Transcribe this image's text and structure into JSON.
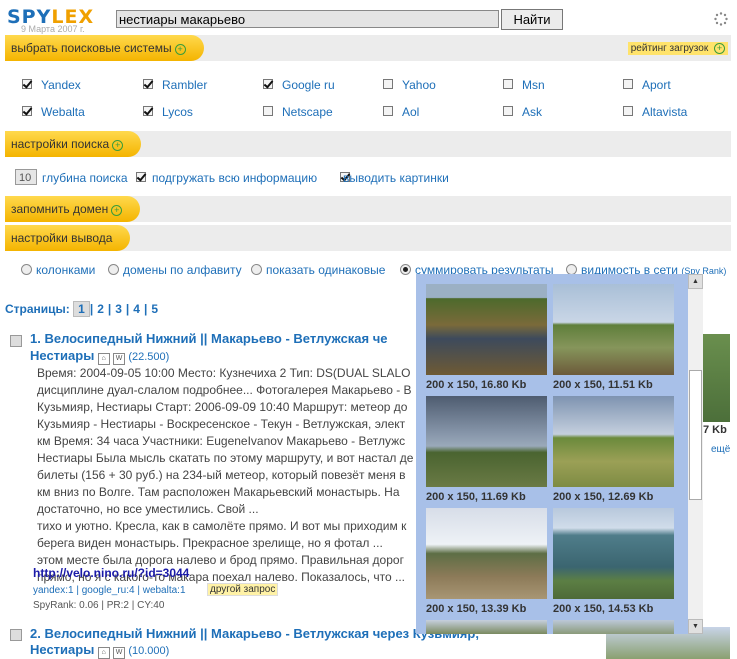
{
  "header": {
    "logo": {
      "part1": "SPY",
      "part2": "LEX"
    },
    "date": "9 Марта 2007 г.",
    "search_value": "нестиары макарьево",
    "find_label": "Найти"
  },
  "engines_bar": {
    "label": "выбрать поисковые системы",
    "rating": "рейтинг загрузок"
  },
  "engines": [
    {
      "name": "Yandex",
      "checked": true
    },
    {
      "name": "Rambler",
      "checked": true
    },
    {
      "name": "Google ru",
      "checked": true
    },
    {
      "name": "Yahoo",
      "checked": false
    },
    {
      "name": "Msn",
      "checked": false
    },
    {
      "name": "Aport",
      "checked": false
    },
    {
      "name": "Webalta",
      "checked": true
    },
    {
      "name": "Lycos",
      "checked": true
    },
    {
      "name": "Netscape",
      "checked": false
    },
    {
      "name": "Aol",
      "checked": false
    },
    {
      "name": "Ask",
      "checked": false
    },
    {
      "name": "Altavista",
      "checked": false
    }
  ],
  "search_settings": {
    "label": "настройки поиска",
    "depth_value": "10",
    "depth_label": "глубина поиска",
    "load_all": "подгружать всю информацию",
    "show_images": "выводить картинки"
  },
  "remember_domain": {
    "label": "запомнить домен"
  },
  "output_settings": {
    "label": "настройки вывода"
  },
  "output_modes": [
    {
      "label": "колонками",
      "selected": false
    },
    {
      "label": "домены по алфавиту",
      "selected": false
    },
    {
      "label": "показать одинаковые",
      "selected": false
    },
    {
      "label": "суммировать результаты",
      "selected": true
    },
    {
      "label": "видимость в сети",
      "suffix": "(Spy Rank)",
      "selected": false
    }
  ],
  "pagination": {
    "label": "Страницы:",
    "pages": [
      "1",
      "2",
      "3",
      "4",
      "5"
    ],
    "current": "1"
  },
  "results": [
    {
      "title_line1": "1. Велосипедный Нижний || Макарьево - Ветлужская че",
      "title_line2": "Нестиары",
      "rank": "(22.500)",
      "snippet": [
        "Время: 2004-09-05 10:00 Место: Кузнечиха 2 Тип: DS(DUAL SLALO",
        "дисциплине дуал-слалом подробнее... Фотогалерея Макарьево - В",
        "Кузьмияр, Нестиары Старт: 2006-09-09 10:40 Маршрут: метеор до",
        "Кузьмияр - Нестиары - Воскресенское - Текун - Ветлужская, элект",
        "км Время: 34 часа Участники: EugeneIvanov Макарьево - Ветлужс",
        "Нестиары Была мысль скатать по этому маршруту, и вот настал де",
        "билеты (156 + 30 руб.) на 234-ый метеор, который повезёт меня в",
        "км вниз по Волге. Там расположен Макарьевский монастырь. На",
        "достаточно, но все уместились. Свой ...",
        "тихо и уютно. Кресла, как в самолёте прямо. И вот мы приходим к",
        "берега виден монастырь. Прекрасное зрелище, но я фотал ...",
        "этом месте была дорога налево и брод прямо. Правильная дорог",
        "прямо, но я с какого-то макара поехал налево. Показалось, что ..."
      ],
      "url": "http://velo.nino.ru/?id=3044",
      "meta": "yandex:1 | google_ru:4 | webalta:1",
      "other_query": "другой запрос",
      "spyrank": "SpyRank: 0.06 | PR:2 | CY:40",
      "side_size": "7 Kb",
      "side_more": "ещё"
    },
    {
      "title_line1": "2. Велосипедный Нижний || Макарьево - Ветлужская через Кузьмияр,",
      "title_line2": "Нестиары",
      "rank": "(10.000)"
    }
  ],
  "image_popup": [
    {
      "caption": "200 x 150, 16.80 Kb",
      "scene": "puddle-road"
    },
    {
      "caption": "200 x 150, 11.51 Kb",
      "scene": "field-road"
    },
    {
      "caption": "200 x 150, 11.69 Kb",
      "scene": "cloudy-field"
    },
    {
      "caption": "200 x 150, 12.69 Kb",
      "scene": "meadow"
    },
    {
      "caption": "200 x 150, 13.39 Kb",
      "scene": "village-road"
    },
    {
      "caption": "200 x 150, 14.53 Kb",
      "scene": "lake-pier"
    }
  ],
  "colors": {
    "accent": "#1e6fb8",
    "tab": "#f4b400",
    "bar": "#ececec",
    "popup": "#a8c0e8"
  }
}
